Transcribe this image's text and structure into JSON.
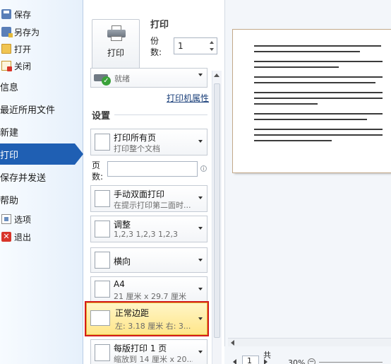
{
  "nav": {
    "save": "保存",
    "save_as": "另存为",
    "open": "打开",
    "close": "关闭",
    "info": "信息",
    "recent": "最近所用文件",
    "new": "新建",
    "print": "打印",
    "save_send": "保存并发送",
    "help": "帮助",
    "options": "选项",
    "exit": "退出",
    "active_color": "#1f5fb3"
  },
  "print": {
    "title": "打印",
    "button_label": "打印",
    "copies_label": "份数:",
    "copies_value": "1"
  },
  "printer": {
    "status": "就绪",
    "properties_link": "打印机属性"
  },
  "settings": {
    "heading": "设置",
    "pages_label": "页数:",
    "pages_value": "",
    "items": [
      {
        "title": "打印所有页",
        "subtitle": "打印整个文档",
        "icon": "pages-icon"
      },
      {
        "title": "手动双面打印",
        "subtitle": "在提示打印第二面时...",
        "icon": "duplex-icon"
      },
      {
        "title": "调整",
        "subtitle": "1,2,3    1,2,3    1,2,3",
        "icon": "collate-icon"
      },
      {
        "title": "横向",
        "subtitle": "",
        "icon": "orientation-icon"
      },
      {
        "title": "A4",
        "subtitle": "21 厘米 x 29.7 厘米",
        "icon": "paper-size-icon"
      },
      {
        "title": "正常边距",
        "subtitle": "左: 3.18 厘米    右: 3...",
        "icon": "margins-icon"
      },
      {
        "title": "每版打印 1 页",
        "subtitle": "缩放到 14 厘米 x 20...",
        "icon": "pages-per-sheet-icon"
      }
    ],
    "highlight_color": "#ffe68a",
    "callout_color": "#d41c1c"
  },
  "preview": {
    "page_number": "1",
    "page_of": "共",
    "zoom": "30%"
  }
}
